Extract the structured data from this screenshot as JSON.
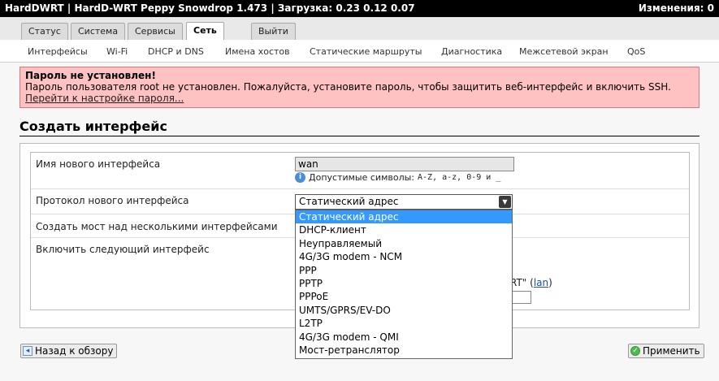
{
  "topbar": {
    "title": "HardDWRT | HardD-WRT Peppy Snowdrop 1.473 | Загрузка: 0.23 0.12 0.07",
    "changes": "Изменения: 0"
  },
  "main_tabs": [
    {
      "label": "Статус"
    },
    {
      "label": "Система"
    },
    {
      "label": "Сервисы"
    },
    {
      "label": "Сеть",
      "active": true
    },
    {
      "label": "Выйти"
    }
  ],
  "sub_tabs": [
    {
      "label": "Интерфейсы"
    },
    {
      "label": "Wi-Fi"
    },
    {
      "label": "DHCP и DNS"
    },
    {
      "label": "Имена хостов"
    },
    {
      "label": "Статические маршруты"
    },
    {
      "label": "Диагностика"
    },
    {
      "label": "Межсетевой экран"
    },
    {
      "label": "QoS"
    }
  ],
  "alert": {
    "title": "Пароль не установлен!",
    "message": "Пароль пользователя root не установлен. Пожалуйста, установите пароль, чтобы защитить веб-интерфейс и включить SSH.",
    "link": "Перейти к настройке пароля..."
  },
  "page_title": "Создать интерфейс",
  "form": {
    "name_label": "Имя нового интерфейса",
    "name_value": "wan",
    "hint_text": "Допустимые символы:",
    "hint_chars": "A-Z, a-z, 0-9 и _",
    "protocol_label": "Протокол нового интерфейса",
    "protocol_value": "Статический адрес",
    "bridge_label": "Создать мост над несколькими интерфейсами",
    "cover_label": "Включить следующий интерфейс",
    "behind_text": "RT\"",
    "behind_link": "lan"
  },
  "protocol_options": [
    "Статический адрес",
    "DHCP-клиент",
    "Неуправляемый",
    "4G/3G modem - NCM",
    "PPP",
    "PPTP",
    "PPPoE",
    "UMTS/GPRS/EV-DO",
    "L2TP",
    "4G/3G modem - QMI",
    "Мост-ретранслятор"
  ],
  "buttons": {
    "back": "Назад к обзору",
    "apply": "Применить"
  }
}
